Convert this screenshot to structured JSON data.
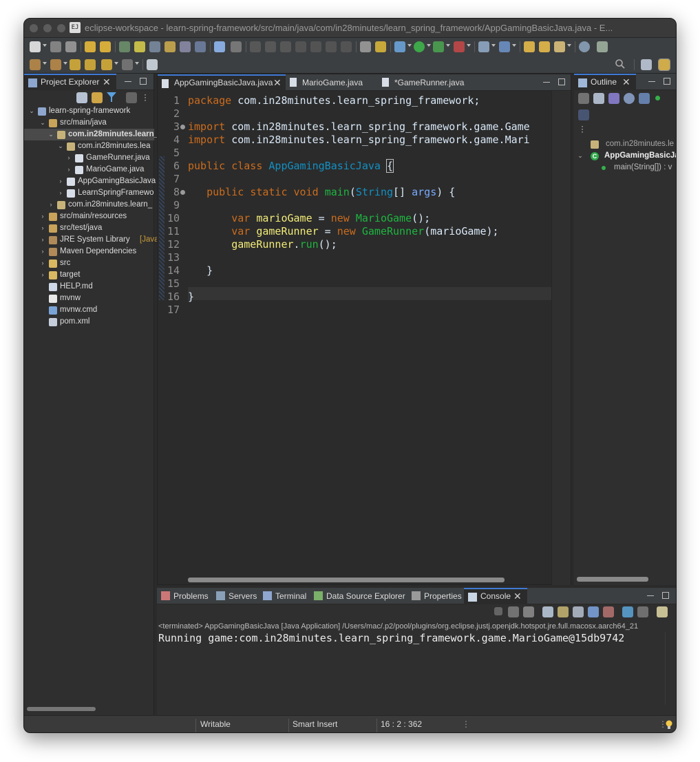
{
  "window": {
    "title": "eclipse-workspace - learn-spring-framework/src/main/java/com/in28minutes/learn_spring_framework/AppGamingBasicJava.java - E...",
    "app_icon_text": "EJ"
  },
  "project_explorer": {
    "tab_label": "Project Explorer",
    "items": [
      {
        "label": "learn-spring-framework",
        "icon": "project-icon",
        "arrow": "down"
      },
      {
        "label": "src/main/java",
        "icon": "source-folder-icon",
        "arrow": "down"
      },
      {
        "label": "com.in28minutes.learn_",
        "icon": "package-icon",
        "arrow": "down",
        "selected": true
      },
      {
        "label": "com.in28minutes.lea",
        "icon": "package-icon",
        "arrow": "down"
      },
      {
        "label": "GameRunner.java",
        "icon": "java-file-icon",
        "arrow": "right"
      },
      {
        "label": "MarioGame.java",
        "icon": "java-file-icon",
        "arrow": "right"
      },
      {
        "label": "AppGamingBasicJava",
        "icon": "java-file-icon",
        "arrow": "right"
      },
      {
        "label": "LearnSpringFramewo",
        "icon": "java-file-icon",
        "arrow": "right"
      },
      {
        "label": "com.in28minutes.learn_",
        "icon": "package-icon",
        "arrow": "right"
      },
      {
        "label": "src/main/resources",
        "icon": "source-folder-icon",
        "arrow": "right"
      },
      {
        "label": "src/test/java",
        "icon": "source-folder-icon",
        "arrow": "right"
      },
      {
        "label": "JRE System Library",
        "suffix": "[JavaS",
        "icon": "library-icon",
        "arrow": "right"
      },
      {
        "label": "Maven Dependencies",
        "icon": "library-icon",
        "arrow": "right"
      },
      {
        "label": "src",
        "icon": "folder-icon",
        "arrow": "right"
      },
      {
        "label": "target",
        "icon": "folder-icon",
        "arrow": "right"
      },
      {
        "label": "HELP.md",
        "icon": "md-file-icon",
        "arrow": ""
      },
      {
        "label": "mvnw",
        "icon": "file-icon",
        "arrow": ""
      },
      {
        "label": "mvnw.cmd",
        "icon": "cmd-file-icon",
        "arrow": ""
      },
      {
        "label": "pom.xml",
        "icon": "xml-file-icon",
        "arrow": ""
      }
    ]
  },
  "editor": {
    "tabs": [
      {
        "label": "AppGamingBasicJava.java",
        "active": true
      },
      {
        "label": "MarioGame.java",
        "active": false
      },
      {
        "label": "*GameRunner.java",
        "active": false
      }
    ],
    "line_numbers": [
      "1",
      "2",
      "3",
      "4",
      "5",
      "6",
      "7",
      "8",
      "9",
      "10",
      "11",
      "12",
      "13",
      "14",
      "15",
      "16",
      "17"
    ],
    "code": {
      "l1a": "package",
      "l1b": " com.in28minutes.learn_spring_framework;",
      "l3a": "import",
      "l3b": " com.in28minutes.learn_spring_framework.game.Game",
      "l4a": "import",
      "l4b": " com.in28minutes.learn_spring_framework.game.Mari",
      "l6a": "public",
      "l6b": "class",
      "l6c": "AppGamingBasicJava",
      "l6d": "{",
      "l8a": "public",
      "l8b": "static",
      "l8c": "void",
      "l8d": "main",
      "l8e": "(",
      "l8f": "String",
      "l8g": "[] ",
      "l8h": "args",
      "l8i": ") {",
      "l10a": "var",
      "l10b": "marioGame",
      "l10c": " = ",
      "l10d": "new",
      "l10e": "MarioGame",
      "l10f": "();",
      "l11a": "var",
      "l11b": "gameRunner",
      "l11c": " = ",
      "l11d": "new",
      "l11e": "GameRunner",
      "l11f": "(marioGame);",
      "l12a": "gameRunner",
      "l12b": ".",
      "l12c": "run",
      "l12d": "();",
      "l14": "}",
      "l16": "}"
    }
  },
  "outline": {
    "tab_label": "Outline",
    "items": [
      {
        "label": "com.in28minutes.le"
      },
      {
        "label": "AppGamingBasicJav"
      },
      {
        "label": "main(String[]) : v"
      }
    ]
  },
  "bottom": {
    "tabs": [
      {
        "label": "Problems"
      },
      {
        "label": "Servers"
      },
      {
        "label": "Terminal"
      },
      {
        "label": "Data Source Explorer"
      },
      {
        "label": "Properties"
      },
      {
        "label": "Console",
        "active": true
      }
    ],
    "terminated_line": "<terminated> AppGamingBasicJava [Java Application] /Users/mac/.p2/pool/plugins/org.eclipse.justj.openjdk.hotspot.jre.full.macosx.aarch64_21",
    "output": "Running game:com.in28minutes.learn_spring_framework.game.MarioGame@15db9742"
  },
  "status": {
    "writable": "Writable",
    "insert_mode": "Smart Insert",
    "position": "16 : 2 : 362"
  },
  "colors": {
    "keyword": "#cc6c1d",
    "type": "#1290c3",
    "method": "#1eb540",
    "local_var": "#f3ec79",
    "param": "#79abff",
    "accent": "#3f7ad6"
  }
}
